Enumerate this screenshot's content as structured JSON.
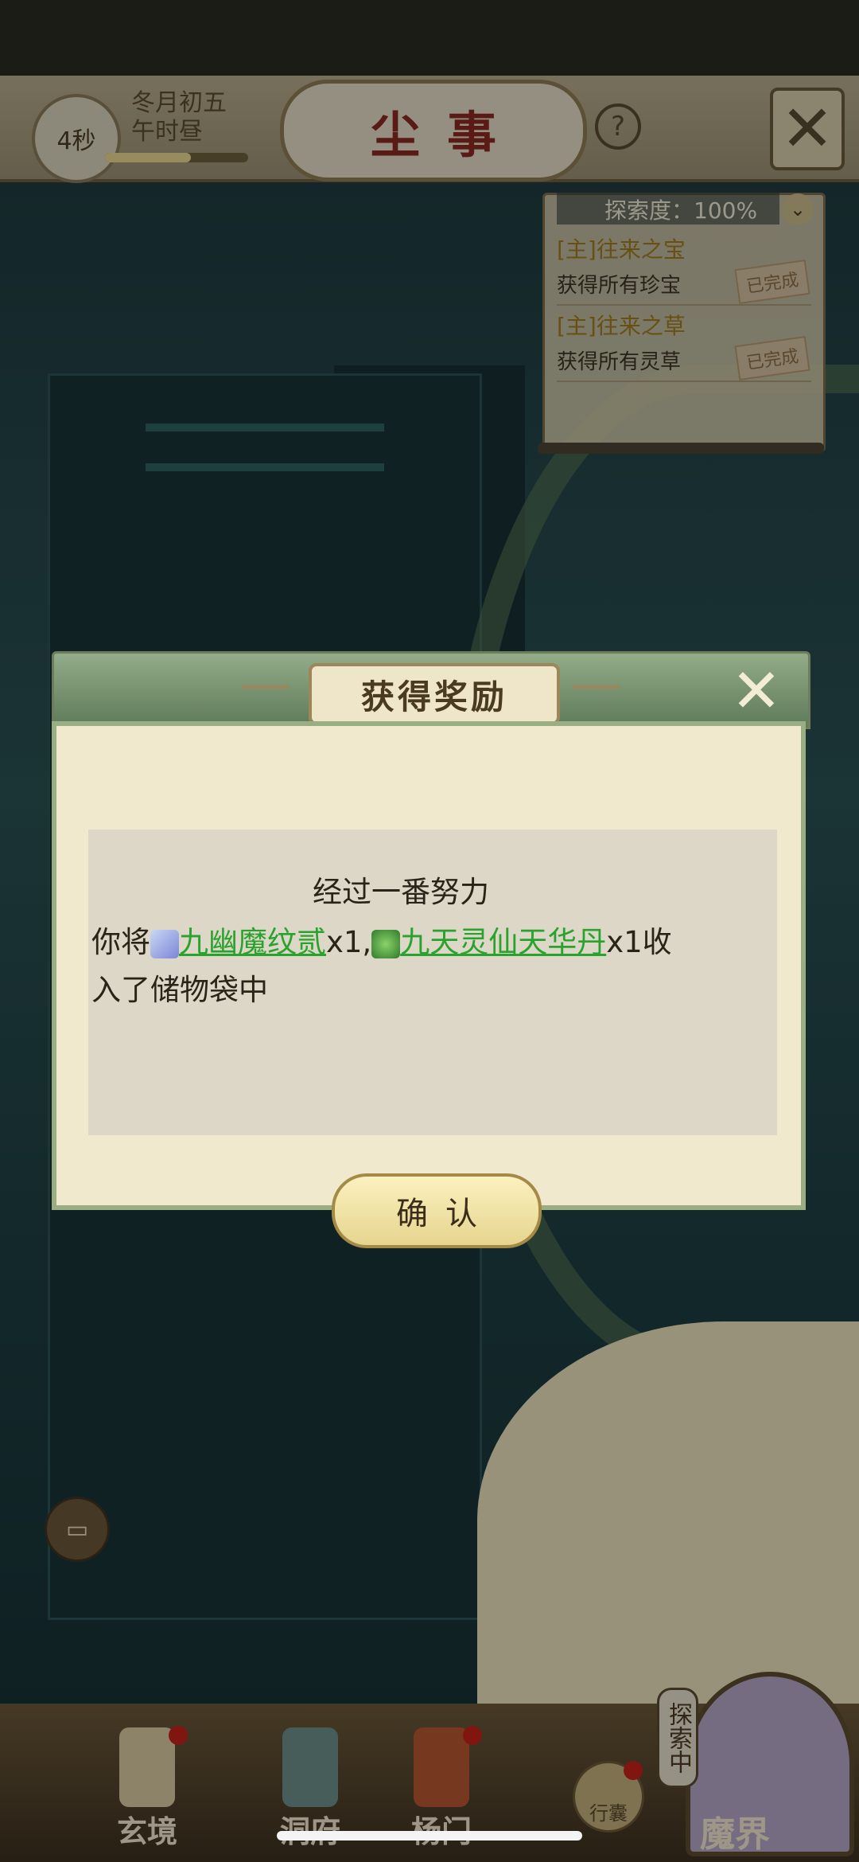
{
  "header": {
    "timer": "4秒",
    "date_line1": "冬月初五",
    "date_line2": "午时昼",
    "time_progress": 0.6,
    "title": "尘事",
    "help_icon": "help-icon",
    "close_icon": "close-icon"
  },
  "quest_panel": {
    "exploration": "探索度：100%",
    "items": [
      {
        "title": "[主]往来之宝",
        "desc": "获得所有珍宝",
        "status": "已完成"
      },
      {
        "title": "[主]往来之草",
        "desc": "获得所有灵草",
        "status": "已完成"
      }
    ]
  },
  "dialog": {
    "title": "获得奖励",
    "message_line1": "经过一番努力",
    "message_prefix": "你将",
    "reward1_name": "九幽魔纹贰",
    "reward1_qty": "x1,",
    "reward2_name": "九天灵仙天华丹",
    "reward2_qty": "x1收",
    "message_suffix": "入了储物袋中",
    "confirm": "确认",
    "colors": {
      "reward_link": "#2aa22e"
    }
  },
  "bottom_nav": {
    "items": [
      {
        "label": "玄境",
        "badge": true
      },
      {
        "label": "洞府",
        "badge": false
      },
      {
        "label": "杨门",
        "badge": true
      }
    ],
    "bag_label": "行囊",
    "explore_tag": "探索中",
    "realm_label": "魔界"
  }
}
